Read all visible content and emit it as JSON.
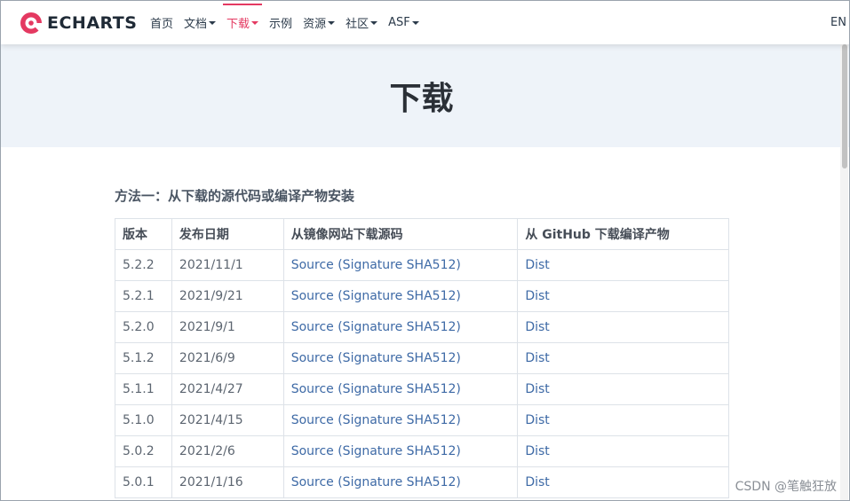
{
  "brand": {
    "name": "ECHARTS",
    "accent": "#e43961"
  },
  "nav": {
    "items": [
      {
        "label": "首页",
        "dropdown": false,
        "active": false
      },
      {
        "label": "文档",
        "dropdown": true,
        "active": false
      },
      {
        "label": "下载",
        "dropdown": true,
        "active": true
      },
      {
        "label": "示例",
        "dropdown": false,
        "active": false
      },
      {
        "label": "资源",
        "dropdown": true,
        "active": false
      },
      {
        "label": "社区",
        "dropdown": true,
        "active": false
      },
      {
        "label": "ASF",
        "dropdown": true,
        "active": false
      }
    ],
    "lang": "EN"
  },
  "hero": {
    "title": "下载"
  },
  "section": {
    "title": "方法一：从下载的源代码或编译产物安装",
    "table": {
      "headers": [
        "版本",
        "发布日期",
        "从镜像网站下载源码",
        "从 GitHub 下载编译产物"
      ],
      "rows": [
        {
          "version": "5.2.2",
          "date": "2021/11/1",
          "source": "Source (Signature SHA512)",
          "dist": "Dist"
        },
        {
          "version": "5.2.1",
          "date": "2021/9/21",
          "source": "Source (Signature SHA512)",
          "dist": "Dist"
        },
        {
          "version": "5.2.0",
          "date": "2021/9/1",
          "source": "Source (Signature SHA512)",
          "dist": "Dist"
        },
        {
          "version": "5.1.2",
          "date": "2021/6/9",
          "source": "Source (Signature SHA512)",
          "dist": "Dist"
        },
        {
          "version": "5.1.1",
          "date": "2021/4/27",
          "source": "Source (Signature SHA512)",
          "dist": "Dist"
        },
        {
          "version": "5.1.0",
          "date": "2021/4/15",
          "source": "Source (Signature SHA512)",
          "dist": "Dist"
        },
        {
          "version": "5.0.2",
          "date": "2021/2/6",
          "source": "Source (Signature SHA512)",
          "dist": "Dist"
        },
        {
          "version": "5.0.1",
          "date": "2021/1/16",
          "source": "Source (Signature SHA512)",
          "dist": "Dist"
        }
      ]
    }
  },
  "watermark": "CSDN @笔触狂放"
}
